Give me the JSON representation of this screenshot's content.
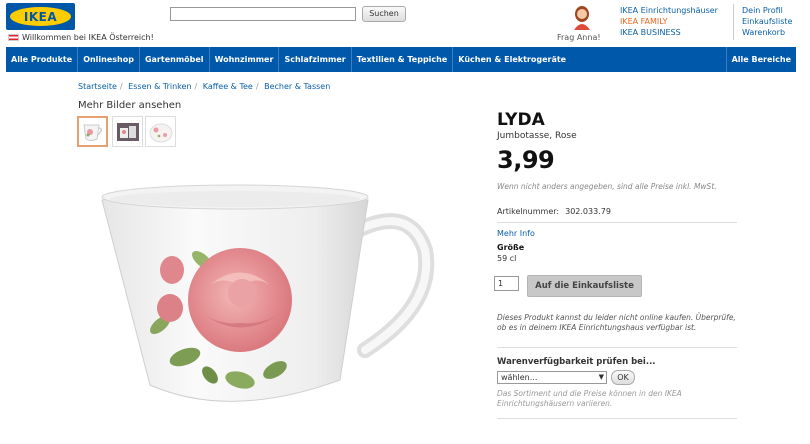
{
  "header": {
    "logo_text": "IKEA",
    "welcome": "Willkommen bei IKEA Österreich!",
    "search": {
      "value": "",
      "button_label": "Suchen"
    },
    "ask_anna": "Frag Anna!",
    "links_col1": [
      "IKEA Einrichtungshäuser",
      "IKEA FAMILY",
      "IKEA BUSINESS"
    ],
    "links_col2": [
      "Dein Profil",
      "Einkaufsliste",
      "Warenkorb"
    ]
  },
  "nav": {
    "items": [
      "Alle Produkte",
      "Onlineshop",
      "Gartenmöbel",
      "Wohnzimmer",
      "Schlafzimmer",
      "Textilien & Teppiche",
      "Küchen & Elektrogeräte"
    ],
    "right_item": "Alle Bereiche"
  },
  "breadcrumb": [
    "Startseite",
    "Essen & Trinken",
    "Kaffee & Tee",
    "Becher & Tassen"
  ],
  "gallery": {
    "label": "Mehr Bilder ansehen"
  },
  "product": {
    "name": "LYDA",
    "description": "Jumbotasse, Rose",
    "price": "3,99",
    "price_note": "Wenn nicht anders angegeben, sind alle Preise inkl. MwSt.",
    "article_label": "Artikelnummer:",
    "article_number": "302.033.79",
    "more_info": "Mehr Info",
    "size_label": "Größe",
    "size_value": "59 cl",
    "quantity": "1",
    "add_to_list": "Auf die Einkaufsliste",
    "unavailable_note": "Dieses Produkt kannst du leider nicht online kaufen. Überprüfe, ob es in deinem IKEA Einrichtungshaus verfügbar ist."
  },
  "availability": {
    "title": "Warenverfügbarkeit prüfen bei...",
    "select_value": "wählen...",
    "ok_label": "OK",
    "note": "Das Sortiment und die Preise können in den IKEA Einrichtungshäusern variieren."
  },
  "colors": {
    "ikea_blue": "#0058ab",
    "ikea_yellow": "#ffcc00",
    "link": "#0a5fa6",
    "family_orange": "#e8641b"
  }
}
